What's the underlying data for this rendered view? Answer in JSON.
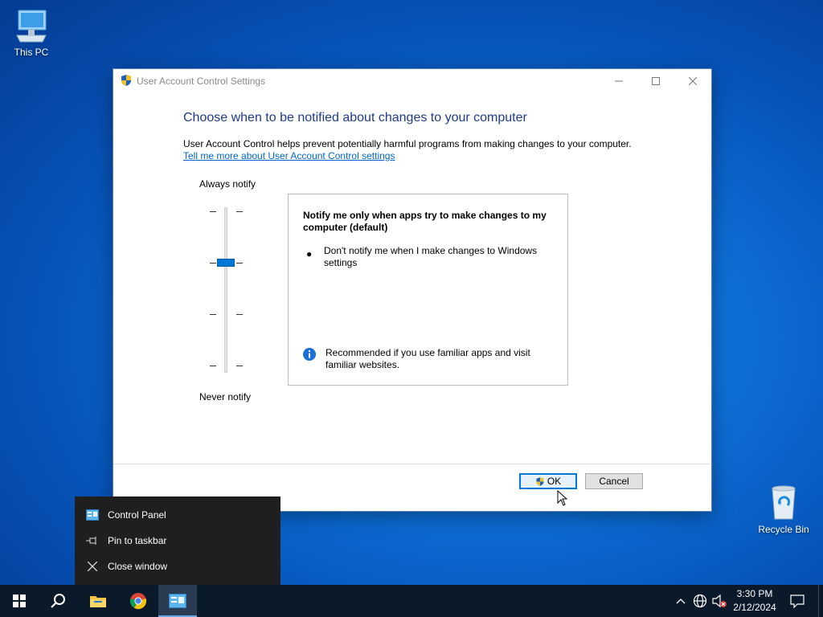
{
  "desktop": {
    "this_pc_label": "This PC",
    "recycle_bin_label": "Recycle Bin"
  },
  "window": {
    "title": "User Account Control Settings",
    "heading": "Choose when to be notified about changes to your computer",
    "description": "User Account Control helps prevent potentially harmful programs from making changes to your computer.",
    "link": "Tell me more about User Account Control settings",
    "slider": {
      "top_label": "Always notify",
      "bottom_label": "Never notify",
      "levels": 4,
      "selected_level": 3
    },
    "info": {
      "title": "Notify me only when apps try to make changes to my computer (default)",
      "bullet": "Don't notify me when I make changes to Windows settings",
      "recommendation": "Recommended if you use familiar apps and visit familiar websites."
    },
    "buttons": {
      "ok": "OK",
      "cancel": "Cancel"
    }
  },
  "jumplist": {
    "items": [
      {
        "label": "Control Panel",
        "icon": "control-panel-icon"
      },
      {
        "label": "Pin to taskbar",
        "icon": "pin-icon"
      },
      {
        "label": "Close window",
        "icon": "close-icon"
      }
    ]
  },
  "taskbar": {
    "time": "3:30 PM",
    "date": "2/12/2024"
  },
  "colors": {
    "accent": "#0078d7",
    "heading": "#1e3b8a",
    "link": "#0066cc"
  }
}
